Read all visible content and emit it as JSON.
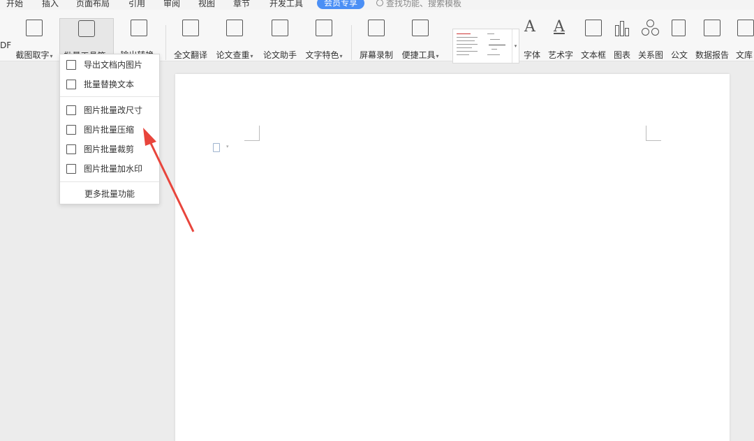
{
  "menu": {
    "tabs": [
      "开始",
      "插入",
      "页面布局",
      "引用",
      "审阅",
      "视图",
      "章节",
      "开发工具"
    ],
    "member_tab": "会员专享",
    "search_placeholder": "查找功能、搜索模板"
  },
  "ribbon": {
    "cut_left_label": "DF",
    "buttons": [
      {
        "label": "截图取字",
        "icon": "screenshot-text-icon",
        "dropdown": true
      },
      {
        "label": "批量工具箱",
        "icon": "toolbox-icon",
        "dropdown": true,
        "active": true
      },
      {
        "label": "输出转换",
        "icon": "convert-icon",
        "dropdown": true
      },
      {
        "label": "全文翻译",
        "icon": "translate-icon",
        "dropdown": false
      },
      {
        "label": "论文查重",
        "icon": "plagiarism-check-icon",
        "dropdown": true
      },
      {
        "label": "论文助手",
        "icon": "paper-assistant-icon",
        "dropdown": false
      },
      {
        "label": "文字特色",
        "icon": "text-feature-icon",
        "dropdown": true
      },
      {
        "label": "屏幕录制",
        "icon": "screen-record-icon",
        "dropdown": false
      },
      {
        "label": "便捷工具",
        "icon": "quick-tools-icon",
        "dropdown": true
      },
      {
        "label": "字体",
        "icon": "font-icon",
        "dropdown": false
      },
      {
        "label": "艺术字",
        "icon": "wordart-icon",
        "dropdown": false
      },
      {
        "label": "文本框",
        "icon": "textbox-icon",
        "dropdown": false
      },
      {
        "label": "图表",
        "icon": "chart-icon",
        "dropdown": false
      },
      {
        "label": "关系图",
        "icon": "relationship-icon",
        "dropdown": false
      },
      {
        "label": "公文",
        "icon": "document-icon",
        "dropdown": false
      },
      {
        "label": "数据报告",
        "icon": "data-report-icon",
        "dropdown": false
      },
      {
        "label": "文库",
        "icon": "library-icon",
        "dropdown": false
      }
    ]
  },
  "dropdown": {
    "items": [
      {
        "label": "导出文档内图片",
        "icon": "export-image-icon"
      },
      {
        "label": "批量替换文本",
        "icon": "replace-text-icon"
      },
      {
        "label": "图片批量改尺寸",
        "icon": "resize-image-icon"
      },
      {
        "label": "图片批量压缩",
        "icon": "compress-image-icon"
      },
      {
        "label": "图片批量裁剪",
        "icon": "crop-image-icon"
      },
      {
        "label": "图片批量加水印",
        "icon": "watermark-image-icon"
      }
    ],
    "more_label": "更多批量功能"
  },
  "colors": {
    "member_pill": "#4b8ff5",
    "arrow": "#e8453c"
  }
}
